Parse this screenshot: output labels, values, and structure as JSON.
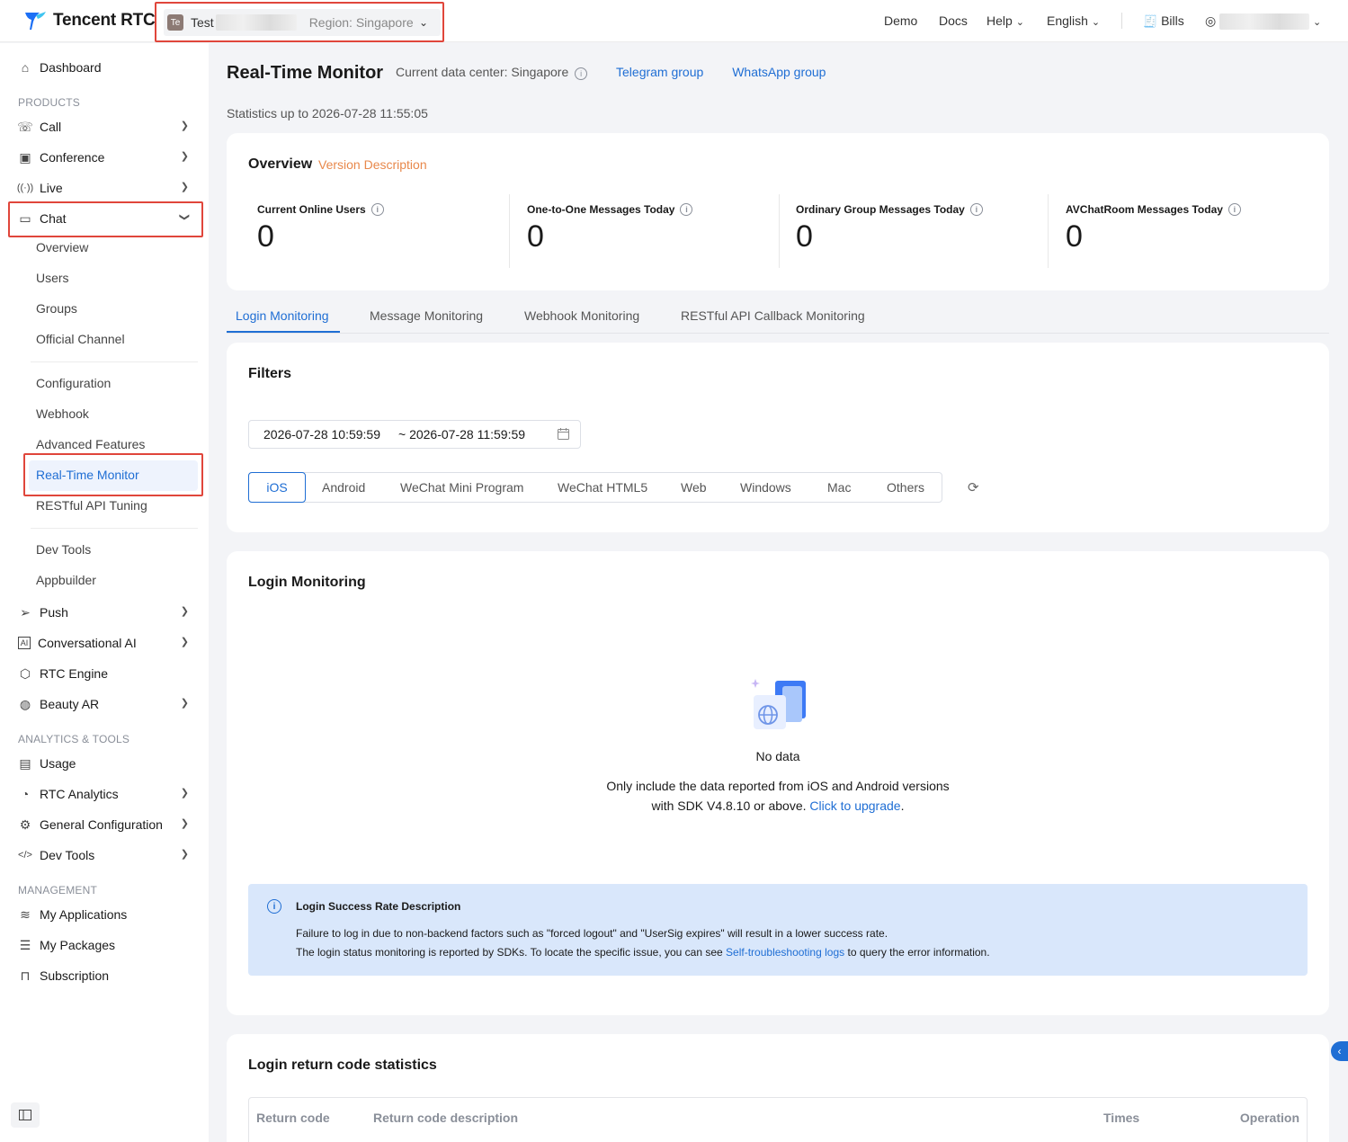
{
  "brand": {
    "name": "Tencent RTC"
  },
  "app_selector": {
    "badge": "Te",
    "name": "Test",
    "region": "Region: Singapore"
  },
  "topnav": {
    "demo": "Demo",
    "docs": "Docs",
    "help": "Help",
    "language": "English",
    "bills": "Bills"
  },
  "sidebar": {
    "dashboard": "Dashboard",
    "section_products": "PRODUCTS",
    "call": "Call",
    "conference": "Conference",
    "live": "Live",
    "chat": "Chat",
    "chat_sub": [
      "Overview",
      "Users",
      "Groups",
      "Official Channel",
      "Configuration",
      "Webhook",
      "Advanced Features",
      "Real-Time Monitor",
      "RESTful API Tuning",
      "Dev Tools",
      "Appbuilder"
    ],
    "push": "Push",
    "conversational_ai": "Conversational AI",
    "rtc_engine": "RTC Engine",
    "beauty_ar": "Beauty AR",
    "section_analytics": "ANALYTICS & TOOLS",
    "usage": "Usage",
    "rtc_analytics": "RTC Analytics",
    "general_configuration": "General Configuration",
    "dev_tools": "Dev Tools",
    "section_management": "MANAGEMENT",
    "my_applications": "My Applications",
    "my_packages": "My Packages",
    "subscription": "Subscription"
  },
  "header": {
    "title": "Real-Time Monitor",
    "data_center": "Current data center: Singapore",
    "telegram": "Telegram group",
    "whatsapp": "WhatsApp group",
    "stats_up_to": "Statistics up to 2026-07-28 11:55:05"
  },
  "overview": {
    "title": "Overview",
    "version_link": "Version Description",
    "metrics": [
      {
        "label": "Current Online Users",
        "value": "0"
      },
      {
        "label": "One-to-One Messages Today",
        "value": "0"
      },
      {
        "label": "Ordinary Group Messages Today",
        "value": "0"
      },
      {
        "label": "AVChatRoom Messages Today",
        "value": "0"
      }
    ]
  },
  "tabs": [
    "Login Monitoring",
    "Message Monitoring",
    "Webhook Monitoring",
    "RESTful API Callback Monitoring"
  ],
  "filters": {
    "title": "Filters",
    "start": "2026-07-28 10:59:59",
    "end": "~ 2026-07-28 11:59:59",
    "platforms": [
      "iOS",
      "Android",
      "WeChat Mini Program",
      "WeChat HTML5",
      "Web",
      "Windows",
      "Mac",
      "Others"
    ],
    "selected_platform": "iOS"
  },
  "login_monitoring": {
    "title": "Login Monitoring",
    "no_data": "No data",
    "desc_line1": "Only include the data reported from iOS and Android versions",
    "desc_line2": "with SDK V4.8.10 or above.",
    "upgrade_link": "Click to upgrade",
    "period": ".",
    "notice": {
      "title": "Login Success Rate Description",
      "line1": "Failure to log in due to non-backend factors such as \"forced logout\" and \"UserSig expires\" will result in a lower success rate.",
      "line2_prefix": "The login status monitoring is reported by SDKs. To locate the specific issue, you can see",
      "line2_link": "Self-troubleshooting logs",
      "line2_suffix": "to query the error information."
    }
  },
  "return_codes": {
    "title": "Login return code statistics",
    "columns": [
      "Return code",
      "Return code description",
      "Times",
      "Operation"
    ]
  },
  "colors": {
    "accent": "#1f6ed4",
    "highlight": "#e0463b",
    "version": "#e8884b"
  }
}
